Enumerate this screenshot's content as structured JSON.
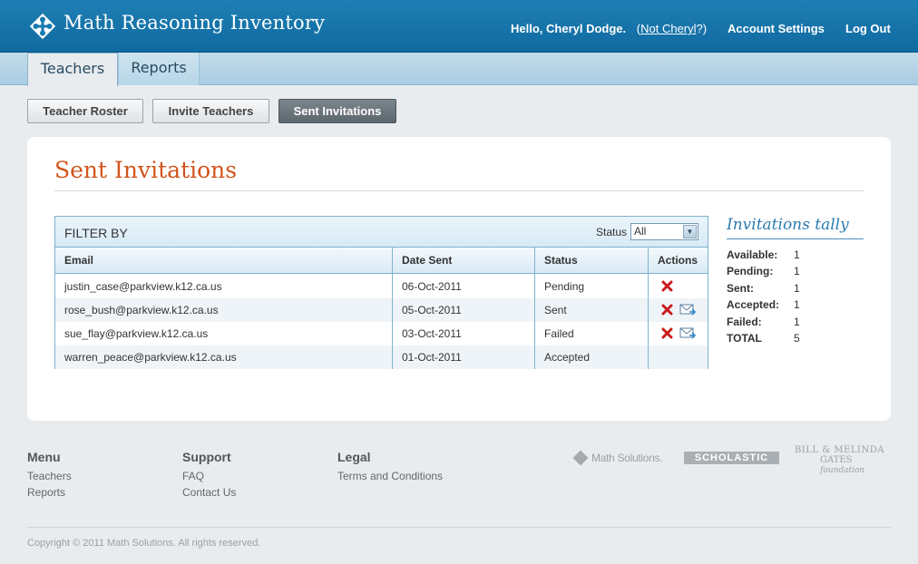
{
  "header": {
    "app_title": "Math Reasoning Inventory",
    "greeting": "Hello, Cheryl Dodge.",
    "not_user_link": "Not Cheryl",
    "not_user_open": "(",
    "not_user_close": "?)",
    "account_settings": "Account Settings",
    "log_out": "Log Out"
  },
  "tabs": [
    {
      "label": "Teachers",
      "active": true
    },
    {
      "label": "Reports",
      "active": false
    }
  ],
  "subnav": [
    {
      "label": "Teacher Roster",
      "active": false
    },
    {
      "label": "Invite Teachers",
      "active": false
    },
    {
      "label": "Sent Invitations",
      "active": true
    }
  ],
  "main": {
    "page_title": "Sent Invitations",
    "filter_label": "FILTER BY",
    "status_filter_label": "Status",
    "status_filter_value": "All",
    "columns": [
      "Email",
      "Date Sent",
      "Status",
      "Actions"
    ],
    "rows": [
      {
        "email": "justin_case@parkview.k12.ca.us",
        "date": "06-Oct-2011",
        "status": "Pending",
        "actions": [
          "delete"
        ]
      },
      {
        "email": "rose_bush@parkview.k12.ca.us",
        "date": "05-Oct-2011",
        "status": "Sent",
        "actions": [
          "delete",
          "resend"
        ]
      },
      {
        "email": "sue_flay@parkview.k12.ca.us",
        "date": "03-Oct-2011",
        "status": "Failed",
        "actions": [
          "delete",
          "resend"
        ]
      },
      {
        "email": "warren_peace@parkview.k12.ca.us",
        "date": "01-Oct-2011",
        "status": "Accepted",
        "actions": []
      }
    ]
  },
  "tally": {
    "title": "Invitations tally",
    "items": [
      {
        "label": "Available:",
        "value": "1"
      },
      {
        "label": "Pending:",
        "value": "1"
      },
      {
        "label": "Sent:",
        "value": "1"
      },
      {
        "label": "Accepted:",
        "value": "1"
      },
      {
        "label": "Failed:",
        "value": "1"
      },
      {
        "label": "TOTAL",
        "value": "5"
      }
    ]
  },
  "footer": {
    "menu": {
      "heading": "Menu",
      "links": [
        "Teachers",
        "Reports"
      ]
    },
    "support": {
      "heading": "Support",
      "links": [
        "FAQ",
        "Contact Us"
      ]
    },
    "legal": {
      "heading": "Legal",
      "links": [
        "Terms and Conditions"
      ]
    },
    "partners": {
      "math_solutions": "Math Solutions.",
      "scholastic": "SCHOLASTIC",
      "gates_line1": "BILL & MELINDA",
      "gates_line2": "GATES",
      "gates_line3": "foundation"
    },
    "copyright": "Copyright © 2011 Math Solutions. All rights reserved."
  },
  "colors": {
    "header_blue": "#1679b1",
    "title_orange": "#d2541c",
    "tally_blue": "#2b7bb0",
    "delete_red": "#c91b1b"
  }
}
